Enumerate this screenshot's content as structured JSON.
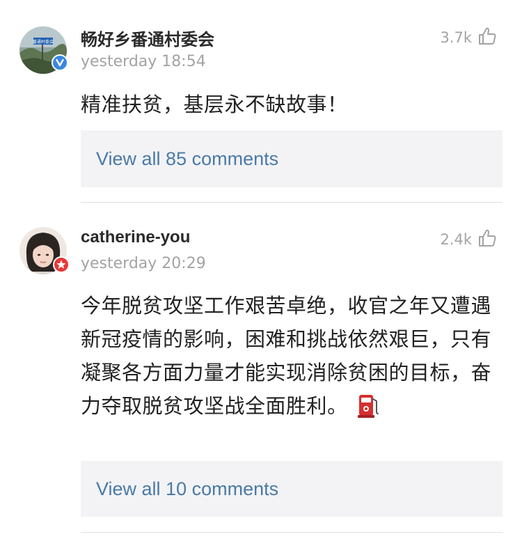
{
  "posts": [
    {
      "username": "畅好乡番通村委会",
      "timestamp": "yesterday 18:54",
      "likes": "3.7k",
      "text": "精准扶贫，基层永不缺故事！",
      "comments_link": "View all 85 comments",
      "badge": "verified-v",
      "avatar_sign_text": "番通村委会"
    },
    {
      "username": "catherine-you",
      "timestamp": "yesterday 20:29",
      "likes": "2.4k",
      "text": "今年脱贫攻坚工作艰苦卓绝，收官之年又遭遇新冠疫情的影响，困难和挑战依然艰巨，只有凝聚各方面力量才能实现消除贫困的目标，奋力夺取脱贫攻坚战全面胜利。",
      "comments_link": "View all 10 comments",
      "badge": "star",
      "emoji": "fuel-pump-icon"
    }
  ],
  "colors": {
    "link": "#4a7aa6",
    "muted": "#a3a3a3",
    "box_bg": "#f3f3f5",
    "verified_badge": "#3a87e0",
    "star_badge": "#e53a3a",
    "fuel_pump": "#d62f2f"
  }
}
